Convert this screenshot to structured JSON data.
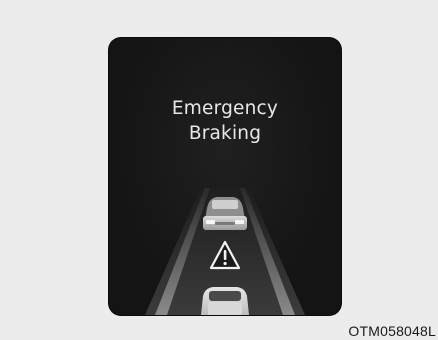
{
  "display": {
    "message_line_1": "Emergency",
    "message_line_2": "Braking",
    "warning_icon": "warning-triangle-icon",
    "lead_vehicle_icon": "car-ahead-icon",
    "own_vehicle_icon": "own-car-icon"
  },
  "figure_code": "OTM058048L",
  "colors": {
    "background": "#ececec",
    "panel": "#141414",
    "text": "#e8e8e8",
    "road": "#3a3a3a",
    "lane": "#6a6a6a",
    "highlight": "#f2f2f2"
  }
}
